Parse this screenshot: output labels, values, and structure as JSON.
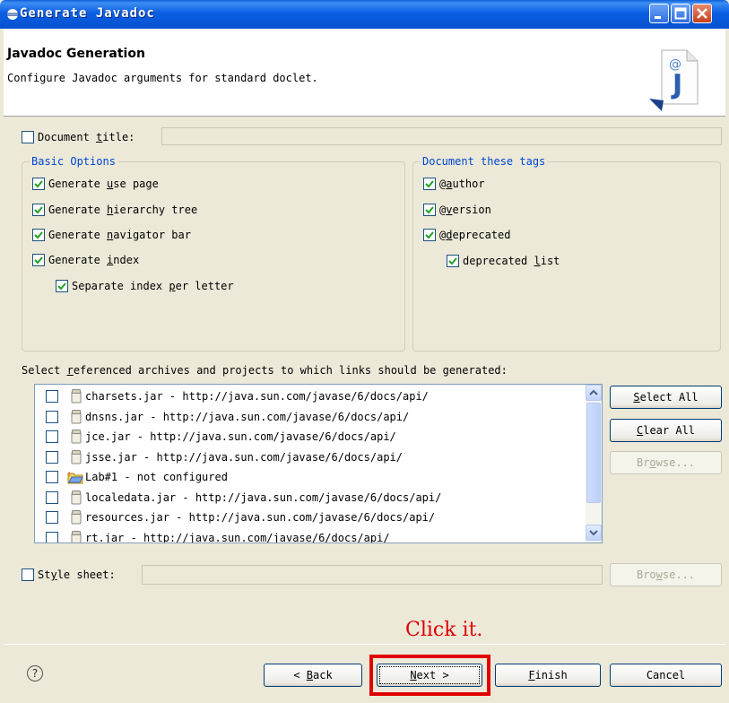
{
  "window": {
    "title": "Generate Javadoc"
  },
  "banner": {
    "title": "Javadoc Generation",
    "description": "Configure Javadoc arguments for standard doclet."
  },
  "document_title": {
    "label_pre": "Document ",
    "label_u": "t",
    "label_post": "itle:",
    "checked": false,
    "value": ""
  },
  "basic_options": {
    "legend": "Basic Options",
    "items": [
      {
        "pre": "Generate ",
        "u": "u",
        "post": "se page",
        "checked": true
      },
      {
        "pre": "Generate ",
        "u": "h",
        "post": "ierarchy tree",
        "checked": true
      },
      {
        "pre": "Generate ",
        "u": "n",
        "post": "avigator bar",
        "checked": true
      },
      {
        "pre": "Generate ",
        "u": "i",
        "post": "ndex",
        "checked": true
      },
      {
        "pre": "Separate index ",
        "u": "p",
        "post": "er letter",
        "checked": true
      }
    ]
  },
  "tags": {
    "legend": "Document these tags",
    "items": [
      {
        "pre": "@",
        "u": "a",
        "post": "uthor",
        "checked": true
      },
      {
        "pre": "@",
        "u": "v",
        "post": "ersion",
        "checked": true
      },
      {
        "pre": "@",
        "u": "d",
        "post": "eprecated",
        "checked": true
      },
      {
        "pre": "deprecated ",
        "u": "l",
        "post": "ist",
        "checked": true
      }
    ]
  },
  "archives": {
    "label_pre": "Select ",
    "label_u": "r",
    "label_post": "eferenced archives and projects to which links should be generated:",
    "items": [
      {
        "text": "charsets.jar - http://java.sun.com/javase/6/docs/api/",
        "icon": "jar-icon"
      },
      {
        "text": "dnsns.jar - http://java.sun.com/javase/6/docs/api/",
        "icon": "jar-icon"
      },
      {
        "text": "jce.jar - http://java.sun.com/javase/6/docs/api/",
        "icon": "jar-icon"
      },
      {
        "text": "jsse.jar - http://java.sun.com/javase/6/docs/api/",
        "icon": "jar-icon"
      },
      {
        "text": "Lab#1 - not configured",
        "icon": "project-folder-icon"
      },
      {
        "text": "localedata.jar - http://java.sun.com/javase/6/docs/api/",
        "icon": "jar-icon"
      },
      {
        "text": "resources.jar - http://java.sun.com/javase/6/docs/api/",
        "icon": "jar-icon"
      },
      {
        "text": "rt.jar - http://java.sun.com/javase/6/docs/api/",
        "icon": "jar-icon"
      }
    ]
  },
  "side_buttons": {
    "select_all": {
      "u": "S",
      "post": "elect All"
    },
    "clear_all": {
      "u": "C",
      "post": "lear All"
    },
    "browse": {
      "pre": "Br",
      "u": "o",
      "post": "wse..."
    }
  },
  "style_sheet": {
    "label_pre": "St",
    "label_u": "y",
    "label_post": "le sheet:",
    "checked": false,
    "browse": {
      "pre": "Bro",
      "u": "w",
      "post": "se..."
    }
  },
  "footer": {
    "help": "?",
    "back": {
      "pre": "< ",
      "u": "B",
      "post": "ack"
    },
    "next": {
      "u": "N",
      "post": "ext >"
    },
    "finish": {
      "u": "F",
      "post": "inish"
    },
    "cancel": "Cancel"
  },
  "annotation": "Click it.",
  "colors": {
    "accent_red": "#e00000",
    "group_legend": "#0046d5",
    "title_bar": "#0b5ee2"
  }
}
